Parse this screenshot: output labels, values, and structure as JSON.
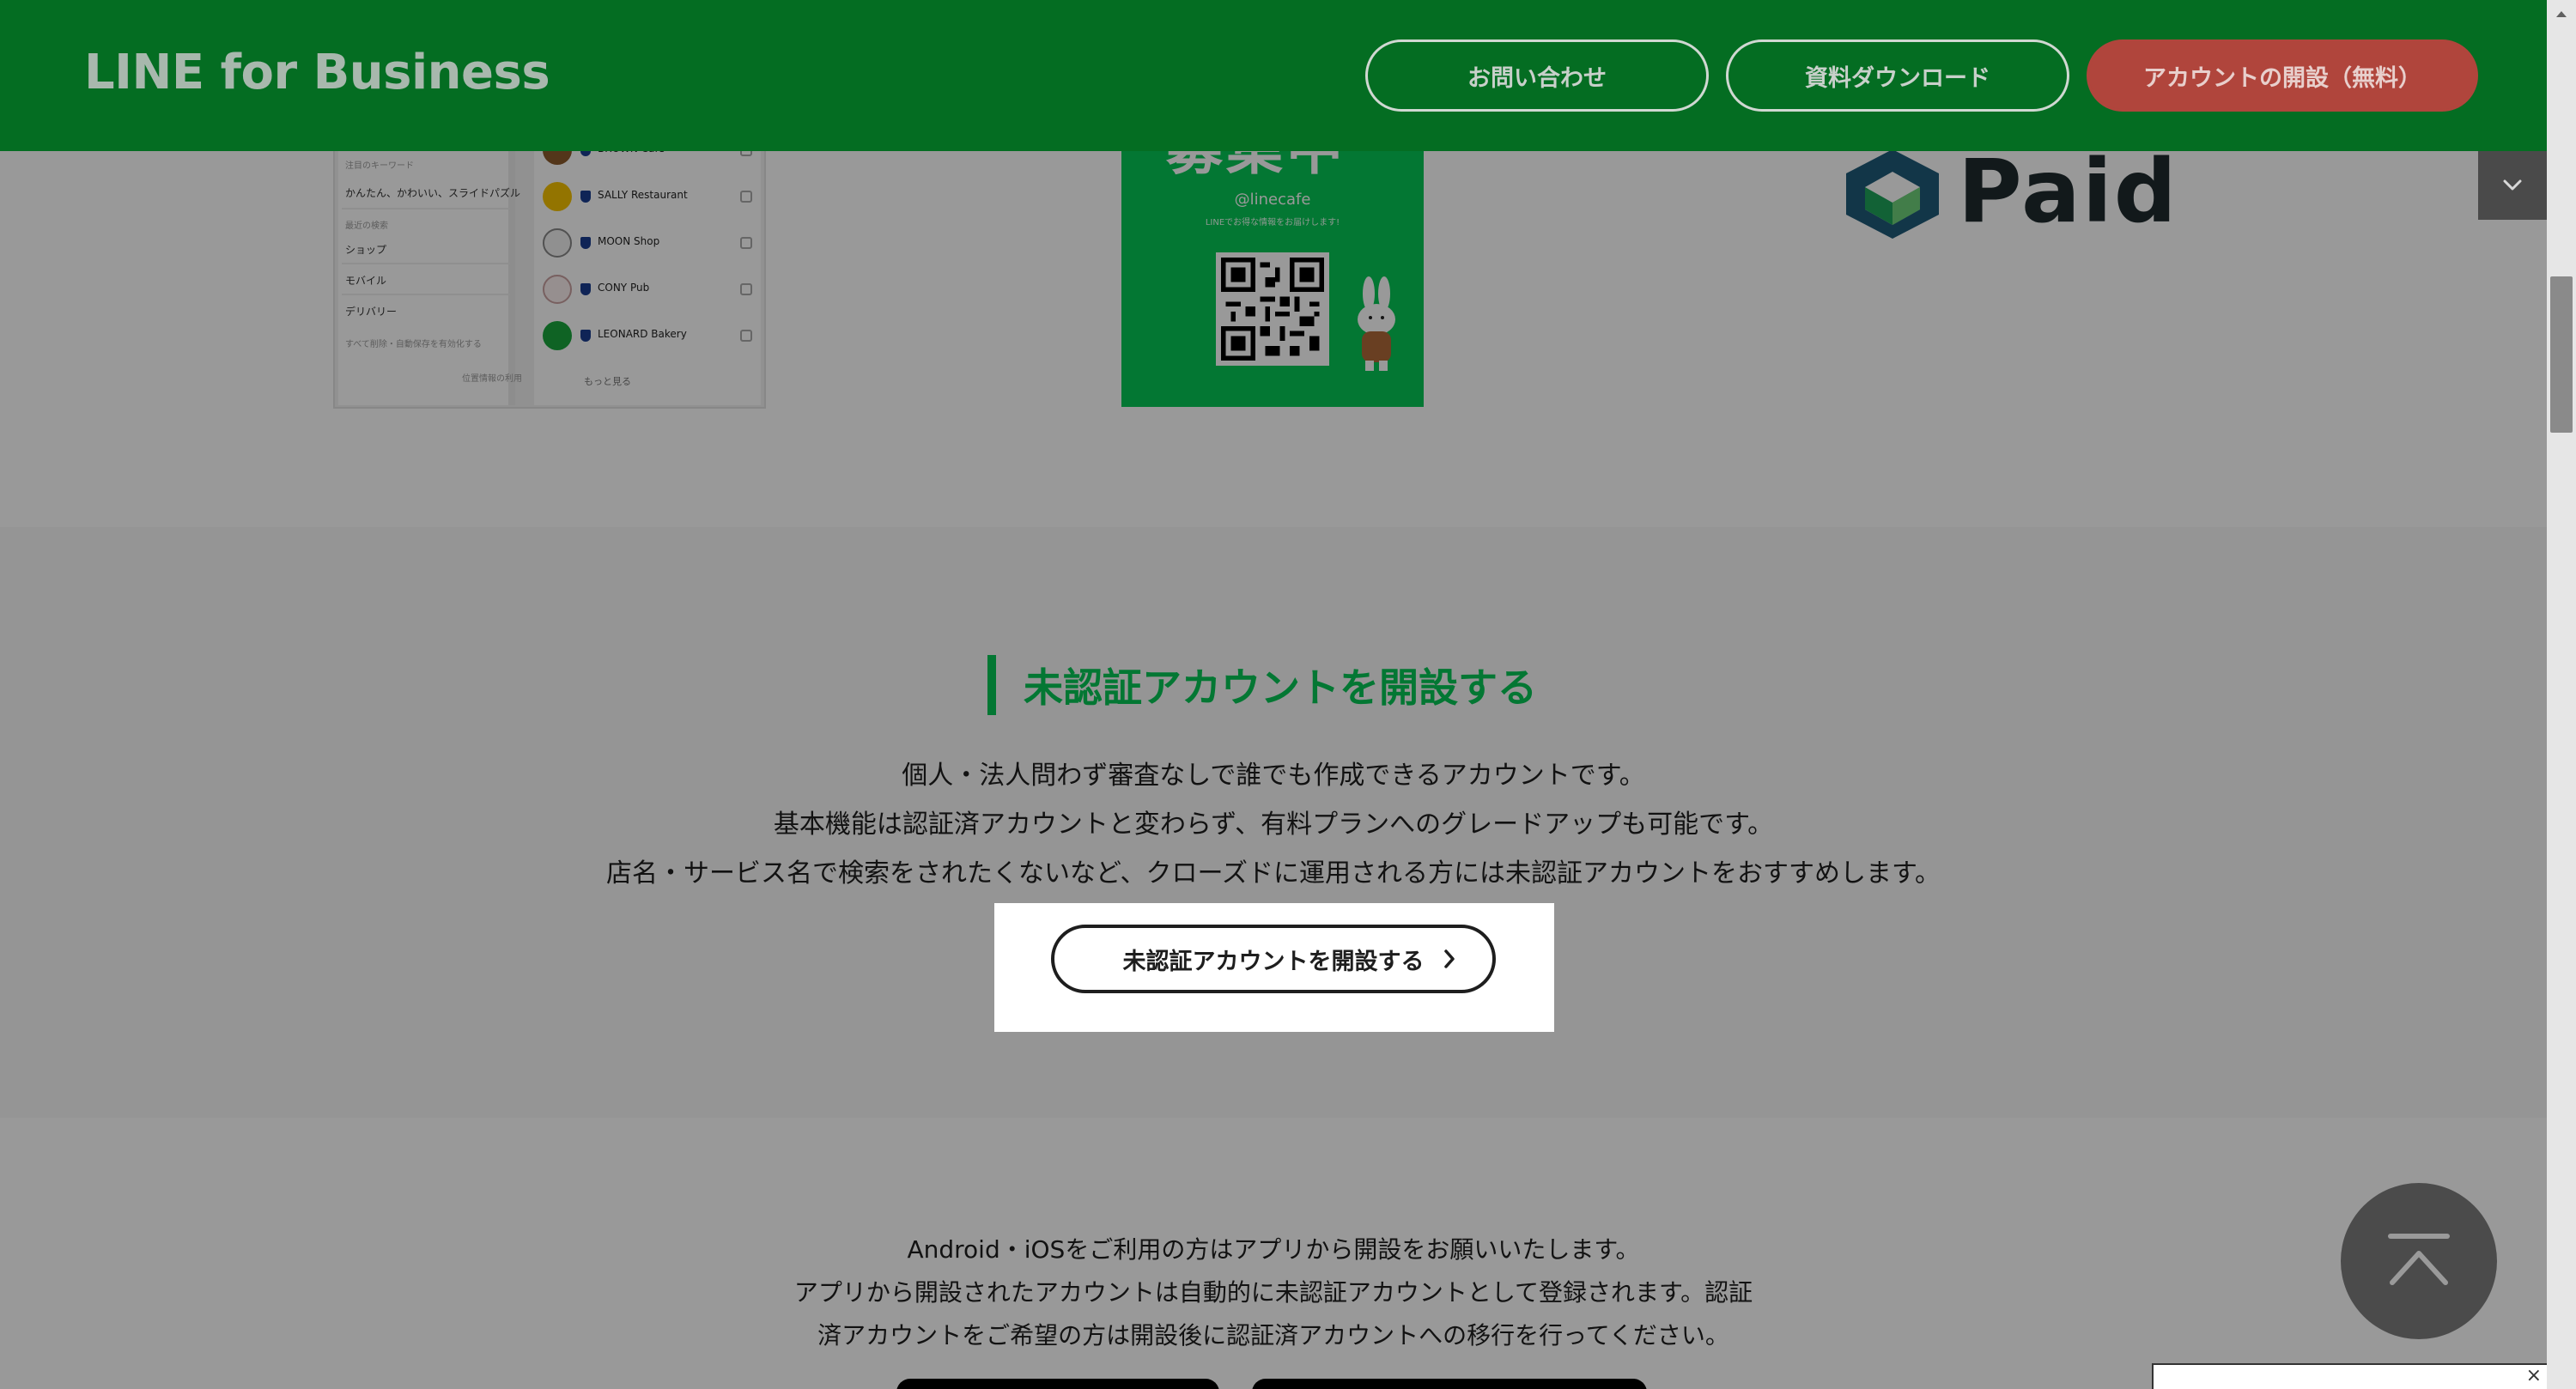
{
  "header": {
    "logo": "LINE for Business",
    "contact_label": "お問い合わせ",
    "download_label": "資料ダウンロード",
    "open_account_label": "アカウントの開設（無料）"
  },
  "phone_mock": {
    "keyword_heading": "注目のキーワード",
    "keywords": "かんたん、かわいい、スライドパズル",
    "recent_heading": "最近の検索",
    "categories": [
      "ショップ",
      "モバイル",
      "デリバリー"
    ],
    "history_note": "すべて削除・自動保存を有効化する",
    "bottom_note": "位置情報の利用",
    "accounts": [
      "BROWN Cafe",
      "SALLY Restaurant",
      "MOON Shop",
      "CONY Pub",
      "LEONARD Bakery"
    ],
    "more": "もっと見る"
  },
  "poster": {
    "headline": "募集中",
    "handle": "@linecafe",
    "subtitle": "LINEでお得な情報をお届けします!"
  },
  "partner_logo": {
    "word": "Paid"
  },
  "unverified_section": {
    "title": "未認証アカウントを開設する",
    "lines": [
      "個人・法人問わず審査なしで誰でも作成できるアカウントです。",
      "基本機能は認証済アカウントと変わらず、有料プランへのグレードアップも可能です。",
      "店名・サービス名で検索をされたくないなど、クローズドに運用される方には未認証アカウントをおすすめします。"
    ],
    "button_label": "未認証アカウントを開設する"
  },
  "app_note": {
    "lines": [
      "Android・iOSをご利用の方はアプリから開設をお願いいたします。",
      "アプリから開設されたアカウントは自動的に未認証アカウントとして登録されます。認証",
      "済アカウントをご希望の方は開設後に認証済アカウントへの移行を行ってください。"
    ]
  },
  "colors": {
    "line_green": "#06c755",
    "header_dimmed": "#046d22",
    "cta_red_dimmed": "#b0453c"
  },
  "icons": {
    "toggle": "chevron-down-icon",
    "scroll_top": "arrow-up-icon",
    "button_chevron": "chevron-right-icon",
    "popup_close": "close-icon"
  }
}
